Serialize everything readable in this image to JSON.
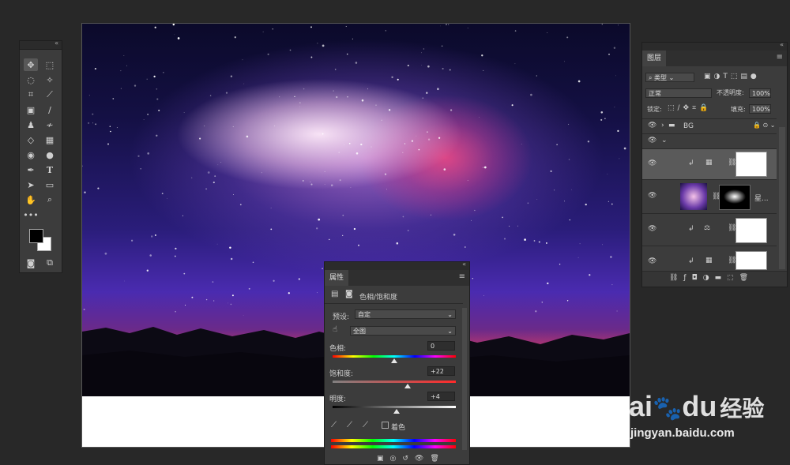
{
  "layers_panel": {
    "tab": "图层",
    "filter_kind": "类型",
    "blend_mode": "正常",
    "opacity_label": "不透明度:",
    "opacity_value": "100%",
    "lock_label": "锁定:",
    "fill_label": "填充:",
    "fill_value": "100%",
    "group_name": "BG",
    "layer_name_partial": "星..."
  },
  "properties_panel": {
    "tab": "属性",
    "title": "色相/饱和度",
    "preset_label": "预设:",
    "preset_value": "自定",
    "channel_value": "全图",
    "hue_label": "色相:",
    "hue_value": "0",
    "saturation_label": "饱和度:",
    "saturation_value": "+22",
    "lightness_label": "明度:",
    "lightness_value": "+4",
    "colorize_label": "着色",
    "hue_fraction": 0.5,
    "saturation_fraction": 0.61,
    "lightness_fraction": 0.52
  },
  "watermark": {
    "brand": "Bai",
    "brand2": "du",
    "cn": "经验",
    "url": "jingyan.baidu.com"
  },
  "colors": {
    "foreground": "#000000",
    "background": "#ffffff"
  }
}
